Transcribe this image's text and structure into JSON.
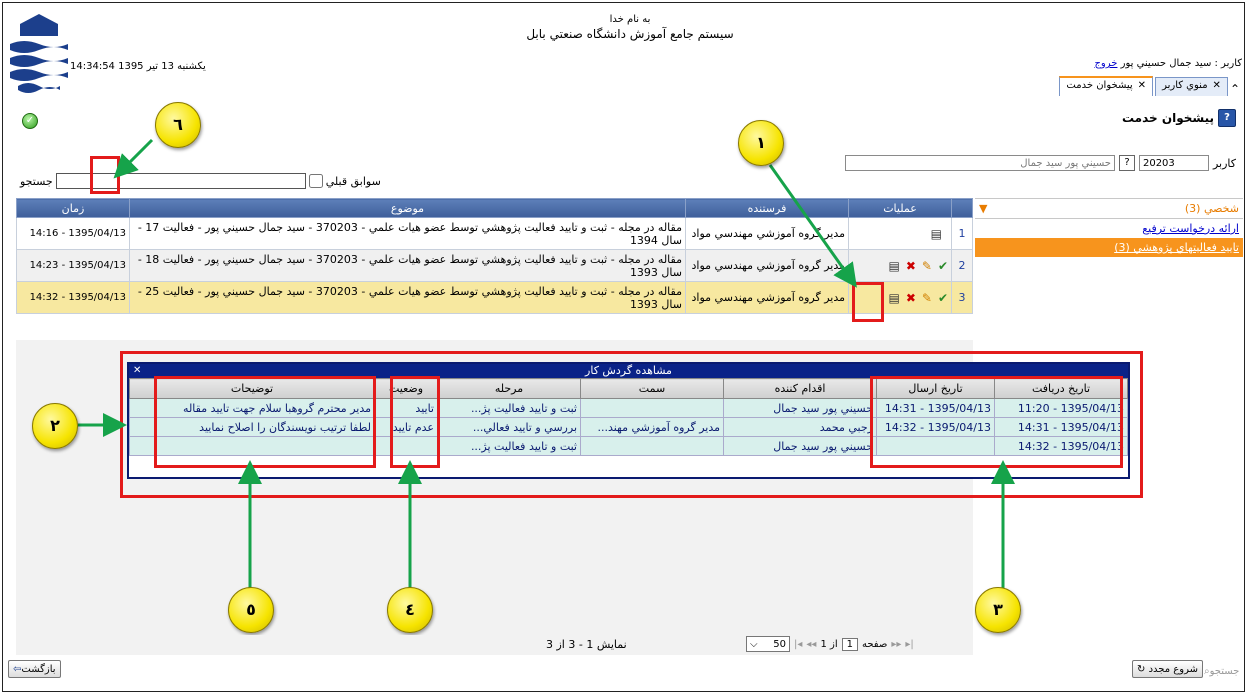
{
  "header": {
    "bismillah": "به نام خدا",
    "system_title": "سيستم جامع آموزش   دانشگاه صنعتي بابل",
    "datetime": "14:34:54 يکشنبه 13 تير 1395",
    "user_prefix": "کاربر : سيد جمال حسيني پور",
    "logout": "خروج"
  },
  "tabs": [
    {
      "label": "پيشخوان خدمت",
      "active": true
    },
    {
      "label": "منوي کاربر",
      "active": false
    }
  ],
  "page_title": "پيشخوان خدمت",
  "user_field": {
    "label": "کاربر",
    "code": "20203",
    "name": "حسيني پور سيد جمال"
  },
  "search": {
    "label": "جستجو",
    "value": "",
    "history_label": "سوابق قبلي"
  },
  "sidebar": {
    "header": "شخصي (3)",
    "items": [
      {
        "label": "ارائه درخواست ترفيع",
        "selected": false
      },
      {
        "label": "تاييد فعاليتهاي پژوهشي (3)",
        "selected": true
      }
    ]
  },
  "main_table": {
    "columns": [
      "عمليات",
      "فرستنده",
      "موضوع",
      "زمان"
    ],
    "rows": [
      {
        "n": "1",
        "sender": "مدير گروه آموزشي مهندسي مواد",
        "subject": "مقاله در مجله - ثبت و تاييد فعاليت پژوهشي توسط عضو هيات علمي - 370203 - سيد جمال حسيني پور - فعاليت 17 - سال 1394",
        "time": "1395/04/13 - 14:16"
      },
      {
        "n": "2",
        "sender": "مدير گروه آموزشي مهندسي مواد",
        "subject": "مقاله در مجله - ثبت و تاييد فعاليت پژوهشي توسط عضو هيات علمي - 370203 - سيد جمال حسيني پور - فعاليت 18 - سال 1393",
        "time": "1395/04/13 - 14:23"
      },
      {
        "n": "3",
        "sender": "مدير گروه آموزشي مهندسي مواد",
        "subject": "مقاله در مجله - ثبت و تاييد فعاليت پژوهشي توسط عضو هيات علمي - 370203 - سيد جمال حسيني پور - فعاليت 25 - سال 1393",
        "time": "1395/04/13 - 14:32"
      }
    ]
  },
  "workflow": {
    "title": "مشاهده گردش کار",
    "columns": [
      "تاريخ دريافت",
      "تاريخ ارسال",
      "اقدام کننده",
      "سمت",
      "مرحله",
      "وضعيت",
      "توضيحات"
    ],
    "rows": [
      [
        "1395/04/13 - 11:20",
        "1395/04/13 - 14:31",
        "حسيني پور سيد جمال",
        "",
        "ثبت و تاييد فعاليت پژ...",
        "تاييد",
        "مدير محترم گروهبا سلام جهت تاييد مقاله"
      ],
      [
        "1395/04/13 - 14:31",
        "1395/04/13 - 14:32",
        "رجبي محمد",
        "مدير گروه آموزشي مهند...",
        "بررسي و تاييد فعالي...",
        "عدم تاييد",
        "لطفا ترتيب نويسندگان را اصلاح نماييد"
      ],
      [
        "1395/04/13 - 14:32",
        "",
        "حسيني پور سيد جمال",
        "",
        "ثبت و تاييد فعاليت پژ...",
        "",
        ""
      ]
    ]
  },
  "pager": {
    "display": "نمايش 1 - 3 از 3",
    "page_label": "صفحه",
    "page": "1",
    "of": "از 1",
    "page_size": "50"
  },
  "buttons": {
    "back": "بازگشت",
    "start": "شروع مجدد",
    "search": "جستجو"
  },
  "callouts": [
    "١",
    "٢",
    "٣",
    "٤",
    "٥",
    "٦"
  ]
}
